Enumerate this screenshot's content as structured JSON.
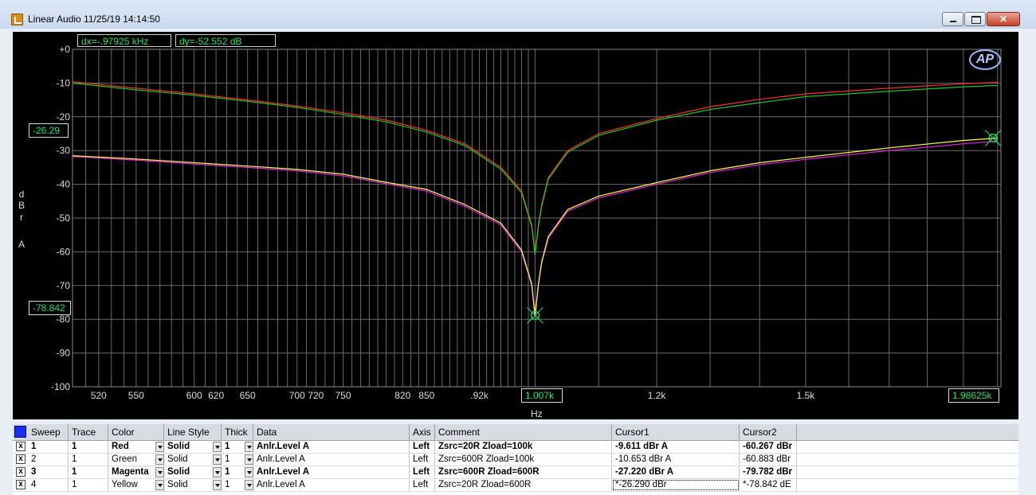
{
  "window": {
    "title": "Linear Audio  11/25/19 14:14:50"
  },
  "graph": {
    "cursor_dx": "dx=-.97925 kHz",
    "cursor_dy": "dy=-52.552  dB",
    "y_axis_label_letters": [
      "d",
      "B",
      "r",
      "A"
    ],
    "y_ticks": [
      "+0",
      "-10",
      "-20",
      "-30",
      "-40",
      "-50",
      "-60",
      "-70",
      "-80",
      "-90",
      "-100"
    ],
    "x_ticks": [
      "520",
      "550",
      "600",
      "620",
      "650",
      "700",
      "720",
      "750",
      "820",
      "850",
      ".92k",
      "1.2k",
      "1.5k"
    ],
    "cursor1_y_flag": "-26.29",
    "cursor2_y_flag": "-78.842",
    "cursor_x1_flag": "1.007k",
    "cursor_x2_flag": "1.98625k",
    "x_axis_unit": "Hz",
    "logo": "AP",
    "colors": {
      "red": "#ff3030",
      "green": "#1ec81e",
      "magenta": "#e020e0",
      "yellow": "#ffff40",
      "grid": "#6a6a6a",
      "cursor": "#19e66a"
    }
  },
  "chart_data": {
    "type": "line",
    "x_scale": "log",
    "xlim": [
      500,
      2010
    ],
    "ylim": [
      -100,
      0
    ],
    "grid": true,
    "series": [
      {
        "name": "Red",
        "x": [
          500,
          550,
          600,
          650,
          700,
          750,
          800,
          850,
          900,
          950,
          980,
          995,
          1000,
          1005,
          1010,
          1020,
          1050,
          1100,
          1200,
          1300,
          1400,
          1500,
          1700,
          1900,
          2000
        ],
        "y": [
          -9.6,
          -11.5,
          -13.2,
          -15.0,
          -16.8,
          -18.8,
          -21.0,
          -24.0,
          -28.0,
          -35.0,
          -42.0,
          -52.0,
          -60.3,
          -52.0,
          -46.0,
          -38.0,
          -30.0,
          -25.0,
          -20.5,
          -17.0,
          -14.8,
          -13.2,
          -11.5,
          -10.2,
          -9.8
        ]
      },
      {
        "name": "Green",
        "x": [
          500,
          550,
          600,
          650,
          700,
          750,
          800,
          850,
          900,
          950,
          980,
          995,
          1000,
          1005,
          1010,
          1020,
          1050,
          1100,
          1200,
          1300,
          1400,
          1500,
          1700,
          1900,
          2000
        ],
        "y": [
          -10.0,
          -12.0,
          -13.6,
          -15.4,
          -17.2,
          -19.3,
          -21.5,
          -24.5,
          -28.5,
          -35.5,
          -42.5,
          -52.5,
          -60.9,
          -52.5,
          -46.5,
          -38.5,
          -30.5,
          -25.5,
          -21.0,
          -17.8,
          -15.8,
          -14.0,
          -12.4,
          -11.1,
          -10.7
        ]
      },
      {
        "name": "Magenta",
        "x": [
          500,
          550,
          600,
          650,
          700,
          750,
          800,
          850,
          900,
          950,
          980,
          995,
          1000,
          1005,
          1010,
          1020,
          1050,
          1100,
          1200,
          1300,
          1400,
          1500,
          1700,
          1900,
          2000
        ],
        "y": [
          -31.8,
          -32.8,
          -34.0,
          -35.0,
          -36.0,
          -37.5,
          -39.8,
          -42.0,
          -46.5,
          -52.0,
          -60.0,
          -70.0,
          -79.8,
          -70.0,
          -63.5,
          -56.0,
          -48.0,
          -44.0,
          -40.0,
          -36.5,
          -34.2,
          -32.6,
          -30.0,
          -28.0,
          -27.2
        ]
      },
      {
        "name": "Yellow",
        "x": [
          500,
          550,
          600,
          650,
          700,
          750,
          800,
          850,
          900,
          950,
          980,
          995,
          1000,
          1005,
          1010,
          1020,
          1050,
          1100,
          1200,
          1300,
          1400,
          1500,
          1700,
          1900,
          2000
        ],
        "y": [
          -31.5,
          -32.5,
          -33.6,
          -34.6,
          -35.6,
          -37.0,
          -39.4,
          -41.5,
          -46.0,
          -51.5,
          -59.5,
          -69.5,
          -78.8,
          -69.5,
          -63.0,
          -55.5,
          -47.5,
          -43.5,
          -39.5,
          -36.0,
          -33.6,
          -32.0,
          -29.2,
          -27.0,
          -26.3
        ]
      }
    ]
  },
  "table": {
    "headers": {
      "sweep": "Sweep",
      "trace": "Trace",
      "color": "Color",
      "line_style": "Line Style",
      "thick": "Thick",
      "data": "Data",
      "axis": "Axis",
      "comment": "Comment",
      "cursor1": "Cursor1",
      "cursor2": "Cursor2"
    },
    "rows": [
      {
        "checked": "x",
        "sweep": "1",
        "trace": "1",
        "color": "Red",
        "line_style": "Solid",
        "thick": "1",
        "data": "Anlr.Level A",
        "axis": "Left",
        "comment": "Zsrc=20R Zload=100k",
        "cursor1": "-9.611  dBr A",
        "cursor2": "-60.267  dBr"
      },
      {
        "checked": "x",
        "sweep": "2",
        "trace": "1",
        "color": "Green",
        "line_style": "Solid",
        "thick": "1",
        "data": "Anlr.Level A",
        "axis": "Left",
        "comment": "Zsrc=600R Zload=100k",
        "cursor1": "-10.653  dBr A",
        "cursor2": "-60.883  dBr"
      },
      {
        "checked": "x",
        "sweep": "3",
        "trace": "1",
        "color": "Magenta",
        "line_style": "Solid",
        "thick": "1",
        "data": "Anlr.Level A",
        "axis": "Left",
        "comment": "Zsrc=600R Zload=600R",
        "cursor1": "-27.220  dBr A",
        "cursor2": "-79.782  dBr"
      },
      {
        "checked": "x",
        "sweep": "4",
        "trace": "1",
        "color": "Yellow",
        "line_style": "Solid",
        "thick": "1",
        "data": "Anlr.Level A",
        "axis": "Left",
        "comment": "Zsrc=20R Zload=600R",
        "cursor1": "*-26.290  dBr",
        "cursor2": "*-78.842  dE"
      }
    ]
  }
}
